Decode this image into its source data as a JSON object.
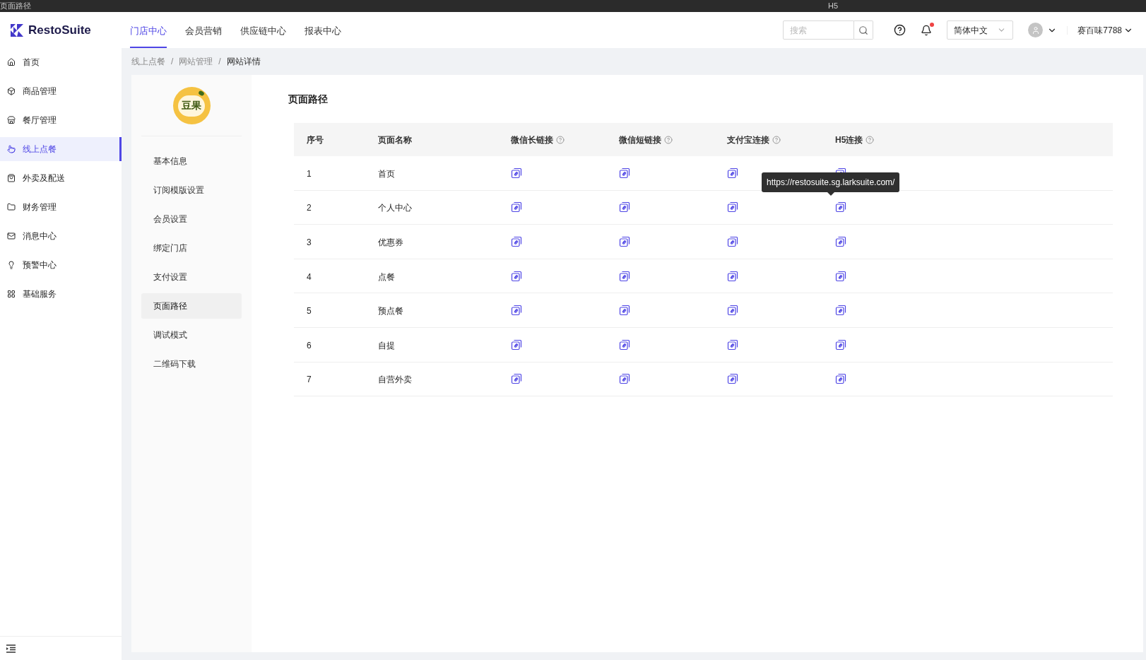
{
  "title_bar": {
    "left_text": "页面路径",
    "center_text": "H5"
  },
  "header": {
    "logo": "RestoSuite",
    "tabs": [
      {
        "label": "门店中心",
        "selected": true
      },
      {
        "label": "会员营销",
        "selected": false
      },
      {
        "label": "供应链中心",
        "selected": false
      },
      {
        "label": "报表中心",
        "selected": false
      }
    ],
    "search": {
      "placeholder": "搜索"
    },
    "notification_dot": true,
    "language": "简体中文",
    "user": "赛百味7788"
  },
  "sidebar": {
    "items": [
      {
        "label": "首页",
        "selected": false
      },
      {
        "label": "商品管理",
        "selected": false
      },
      {
        "label": "餐厅管理",
        "selected": false
      },
      {
        "label": "线上点餐",
        "selected": true
      },
      {
        "label": "外卖及配送",
        "selected": false
      },
      {
        "label": "财务管理",
        "selected": false
      },
      {
        "label": "消息中心",
        "selected": false
      },
      {
        "label": "预警中心",
        "selected": false
      },
      {
        "label": "基础服务",
        "selected": false
      }
    ]
  },
  "breadcrumb": [
    {
      "kind": "link",
      "text": "线上点餐"
    },
    {
      "kind": "separator",
      "text": "/"
    },
    {
      "kind": "link",
      "text": "网站管理"
    },
    {
      "kind": "separator",
      "text": "/"
    },
    {
      "kind": "current",
      "text": "网站详情"
    }
  ],
  "site_logo": "豆果",
  "sub_nav": [
    {
      "label": "基本信息",
      "selected": false
    },
    {
      "label": "订阅模版设置",
      "selected": false
    },
    {
      "label": "会员设置",
      "selected": false
    },
    {
      "label": "绑定门店",
      "selected": false
    },
    {
      "label": "支付设置",
      "selected": false
    },
    {
      "label": "页面路径",
      "selected": true
    },
    {
      "label": "调试模式",
      "selected": false
    },
    {
      "label": "二维码下载",
      "selected": false
    }
  ],
  "section_title": "页面路径",
  "table": {
    "columns": [
      {
        "label": "序号",
        "help": false
      },
      {
        "label": "页面名称",
        "help": false
      },
      {
        "label": "微信长链接",
        "help": true
      },
      {
        "label": "微信短链接",
        "help": true
      },
      {
        "label": "支付宝连接",
        "help": true
      },
      {
        "label": "H5连接",
        "help": true
      }
    ],
    "rows": [
      [
        "1",
        "首页"
      ],
      [
        "2",
        "个人中心"
      ],
      [
        "3",
        "优惠券"
      ],
      [
        "4",
        "点餐"
      ],
      [
        "5",
        "预点餐"
      ],
      [
        "6",
        "自提"
      ],
      [
        "7",
        "自营外卖"
      ]
    ]
  },
  "tooltip": {
    "text": "https://restosuite.sg.larksuite.com/"
  }
}
